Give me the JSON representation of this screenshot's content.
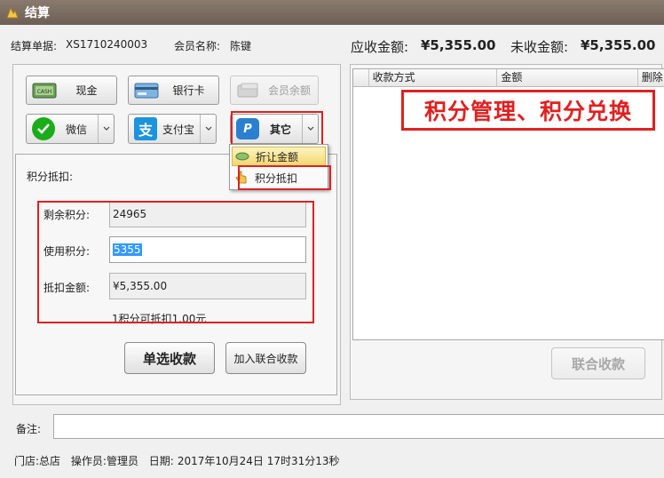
{
  "window": {
    "title": "结算"
  },
  "header": {
    "order_label": "结算单据:",
    "order_no": "XS1710240003",
    "member_label": "会员名称:",
    "member_name": "陈键",
    "receivable_label": "应收金额:",
    "receivable_value": "¥5,355.00",
    "unpaid_label": "未收金额:",
    "unpaid_value": "¥5,355.00"
  },
  "payment_buttons": {
    "cash": "现金",
    "bank_card": "银行卡",
    "member_balance": "会员余额",
    "wechat": "微信",
    "alipay": "支付宝",
    "other": "其它"
  },
  "dropdown_menu": {
    "items": [
      "折让金额",
      "积分抵扣"
    ]
  },
  "points_panel": {
    "title": "积分抵扣:",
    "remaining_label": "剩余积分:",
    "remaining_value": "24965",
    "use_label": "使用积分:",
    "use_value": "5355",
    "deduct_label": "抵扣金额:",
    "deduct_value": "¥5,355.00",
    "rule_text": "1积分可抵扣1.00元"
  },
  "actions": {
    "single_pay": "单选收款",
    "add_combined": "加入联合收款",
    "combined_pay": "联合收款"
  },
  "grid": {
    "columns": [
      "收款方式",
      "金额",
      "删除"
    ]
  },
  "annotation": "积分管理、积分兑换",
  "note": {
    "label": "备注:",
    "value": ""
  },
  "status": {
    "store_label": "门店:",
    "store": "总店",
    "operator_label": "操作员:",
    "operator": "管理员",
    "date_label": "日期:",
    "date": "2017年10月24日 17时31分13秒"
  },
  "colors": {
    "highlight_red": "#e02020",
    "wechat_green": "#1aad19",
    "alipay_blue": "#1b93de",
    "selection_blue": "#3399ff"
  }
}
